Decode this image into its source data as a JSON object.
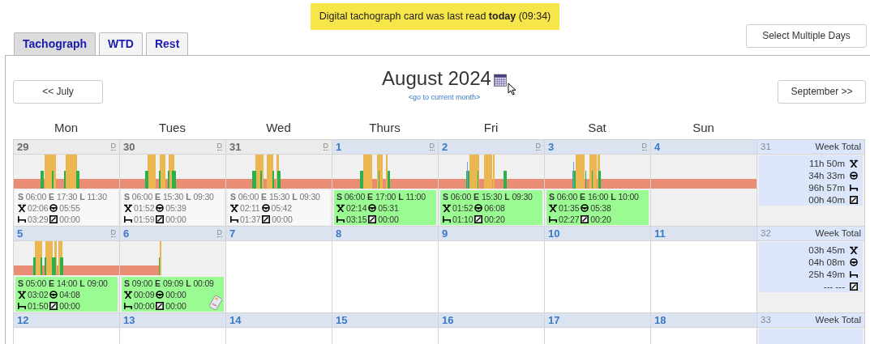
{
  "notice": "Digital tachograph card was last read **today** (09:34)",
  "tabs": [
    {
      "label": "Tachograph",
      "selected": true
    },
    {
      "label": "WTD",
      "selected": false
    },
    {
      "label": "Rest",
      "selected": false
    }
  ],
  "select_button": "Select Multiple Days",
  "nav": {
    "prev": "<< July",
    "title": "August 2024",
    "current_link": "<go to current month>",
    "next": "September >>"
  },
  "weekdays": [
    "Mon",
    "Tues",
    "Wed",
    "Thurs",
    "Fri",
    "Sat",
    "Sun"
  ],
  "weeks": [
    {
      "number": "31",
      "label": "Week Total",
      "totals": [
        {
          "kind": "work",
          "value": "11h 50m"
        },
        {
          "kind": "drive",
          "value": "34h 33m"
        },
        {
          "kind": "rest",
          "value": "96h 57m"
        },
        {
          "kind": "available",
          "value": "00h 40m"
        }
      ],
      "days": [
        {
          "number": "29",
          "in_month": false,
          "d_link": "D",
          "timeline": {
            "kind": "activity"
          },
          "summary": [
            {
              "label": "S",
              "value": "06:00"
            },
            {
              "label": "E",
              "value": "17:30"
            },
            {
              "label": "L",
              "value": "11:30"
            },
            {
              "kind": "work",
              "value": "02:06"
            },
            {
              "kind": "drive",
              "value": "05:55"
            },
            {
              "kind": "rest",
              "value": "03:29"
            },
            {
              "kind": "available",
              "value": "00:00"
            }
          ]
        },
        {
          "number": "30",
          "in_month": false,
          "d_link": "D",
          "timeline": {
            "kind": "activity"
          },
          "summary": [
            {
              "label": "S",
              "value": "06:00"
            },
            {
              "label": "E",
              "value": "15:30"
            },
            {
              "label": "L",
              "value": "09:30"
            },
            {
              "kind": "work",
              "value": "01:52"
            },
            {
              "kind": "drive",
              "value": "05:39"
            },
            {
              "kind": "rest",
              "value": "01:59"
            },
            {
              "kind": "available",
              "value": "00:00"
            }
          ]
        },
        {
          "number": "31",
          "in_month": false,
          "d_link": "D",
          "timeline": {
            "kind": "activity"
          },
          "summary": [
            {
              "label": "S",
              "value": "06:00"
            },
            {
              "label": "E",
              "value": "15:30"
            },
            {
              "label": "L",
              "value": "09:30"
            },
            {
              "kind": "work",
              "value": "02:11"
            },
            {
              "kind": "drive",
              "value": "05:42"
            },
            {
              "kind": "rest",
              "value": "01:37"
            },
            {
              "kind": "available",
              "value": "00:00"
            }
          ]
        },
        {
          "number": "1",
          "in_month": true,
          "d_link": "D",
          "timeline": {
            "kind": "activity"
          },
          "summary": [
            {
              "label": "S",
              "value": "06:00"
            },
            {
              "label": "E",
              "value": "17:00"
            },
            {
              "label": "L",
              "value": "11:00"
            },
            {
              "kind": "work",
              "value": "02:14"
            },
            {
              "kind": "drive",
              "value": "05:31"
            },
            {
              "kind": "rest",
              "value": "03:15"
            },
            {
              "kind": "available",
              "value": "00:00"
            }
          ]
        },
        {
          "number": "2",
          "in_month": true,
          "d_link": "D",
          "timeline": {
            "kind": "activity"
          },
          "summary": [
            {
              "label": "S",
              "value": "06:00"
            },
            {
              "label": "E",
              "value": "15:30"
            },
            {
              "label": "L",
              "value": "09:30"
            },
            {
              "kind": "work",
              "value": "01:52"
            },
            {
              "kind": "drive",
              "value": "06:08"
            },
            {
              "kind": "rest",
              "value": "01:10"
            },
            {
              "kind": "available",
              "value": "00:20"
            }
          ]
        },
        {
          "number": "3",
          "in_month": true,
          "d_link": "D",
          "timeline": {
            "kind": "activity"
          },
          "summary": [
            {
              "label": "S",
              "value": "06:00"
            },
            {
              "label": "E",
              "value": "16:00"
            },
            {
              "label": "L",
              "value": "10:00"
            },
            {
              "kind": "work",
              "value": "01:35"
            },
            {
              "kind": "drive",
              "value": "05:38"
            },
            {
              "kind": "rest",
              "value": "02:27"
            },
            {
              "kind": "available",
              "value": "00:20"
            }
          ]
        },
        {
          "number": "4",
          "in_month": true,
          "timeline": {
            "kind": "rest_only"
          }
        }
      ]
    },
    {
      "number": "32",
      "label": "Week Total",
      "totals": [
        {
          "kind": "work",
          "value": "03h 45m"
        },
        {
          "kind": "drive",
          "value": "04h 08m"
        },
        {
          "kind": "rest",
          "value": "25h 49m"
        },
        {
          "kind": "available",
          "value": "--- ---"
        }
      ],
      "days": [
        {
          "number": "5",
          "in_month": true,
          "d_link": "D",
          "timeline": {
            "kind": "activity"
          },
          "summary": [
            {
              "label": "S",
              "value": "05:00"
            },
            {
              "label": "E",
              "value": "14:00"
            },
            {
              "label": "L",
              "value": "09:00"
            },
            {
              "kind": "work",
              "value": "03:02"
            },
            {
              "kind": "drive",
              "value": "04:08"
            },
            {
              "kind": "rest",
              "value": "01:50"
            },
            {
              "kind": "available",
              "value": "00:00"
            }
          ]
        },
        {
          "number": "6",
          "in_month": true,
          "d_link": "D",
          "timeline": {
            "kind": "partial"
          },
          "card": true,
          "summary": [
            {
              "label": "S",
              "value": "09:00"
            },
            {
              "label": "E",
              "value": "09:09"
            },
            {
              "label": "L",
              "value": "00:09"
            },
            {
              "kind": "work",
              "value": "00:09"
            },
            {
              "kind": "drive",
              "value": "00:00"
            },
            {
              "kind": "rest",
              "value": "00:00"
            },
            {
              "kind": "available",
              "value": "00:00"
            }
          ]
        },
        {
          "number": "7",
          "in_month": true
        },
        {
          "number": "8",
          "in_month": true
        },
        {
          "number": "9",
          "in_month": true
        },
        {
          "number": "10",
          "in_month": true
        },
        {
          "number": "11",
          "in_month": true
        }
      ]
    },
    {
      "number": "33",
      "label": "Week Total",
      "days": [
        {
          "number": "12",
          "in_month": true
        },
        {
          "number": "13",
          "in_month": true
        },
        {
          "number": "14",
          "in_month": true
        },
        {
          "number": "15",
          "in_month": true
        },
        {
          "number": "16",
          "in_month": true
        },
        {
          "number": "17",
          "in_month": true
        },
        {
          "number": "18",
          "in_month": true
        }
      ]
    }
  ]
}
